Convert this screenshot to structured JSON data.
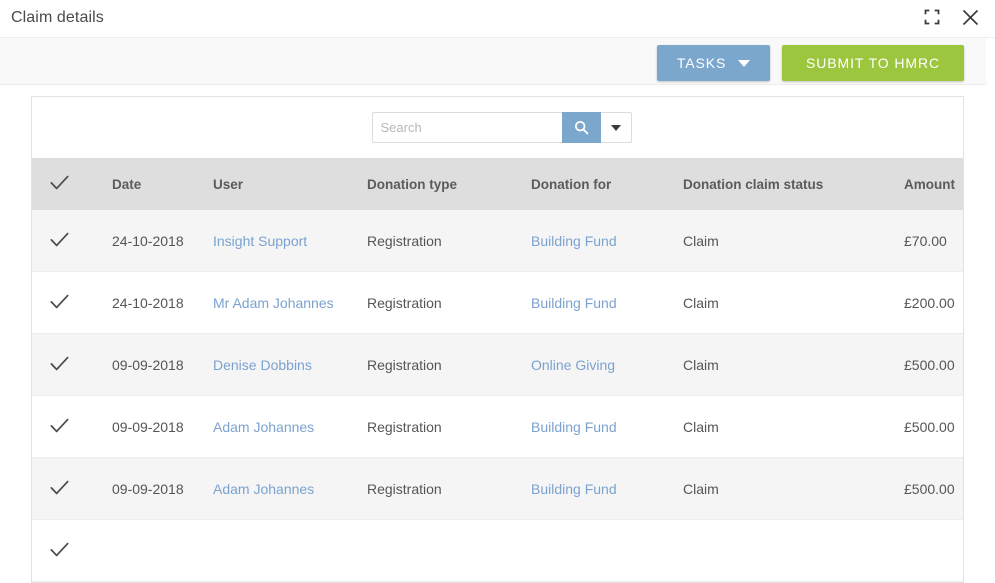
{
  "window": {
    "title": "Claim details",
    "expand_icon": "expand-icon",
    "close_icon": "close-icon"
  },
  "toolbar": {
    "tasks_label": "TASKS",
    "submit_label": "SUBMIT TO HMRC",
    "tasks_color": "#7ba7cd",
    "submit_color": "#9dc63f"
  },
  "search": {
    "placeholder": "Search",
    "value": "",
    "search_icon": "search-icon",
    "dropdown_icon": "chevron-down-icon"
  },
  "table": {
    "select_all_icon": "check-icon",
    "columns": [
      "Date",
      "User",
      "Donation type",
      "Donation for",
      "Donation claim status",
      "Amount"
    ],
    "rows": [
      {
        "date": "24-10-2018",
        "user": "Insight Support",
        "donation_type": "Registration",
        "donation_for": "Building Fund",
        "status": "Claim",
        "amount": "£70.00"
      },
      {
        "date": "24-10-2018",
        "user": "Mr Adam Johannes",
        "donation_type": "Registration",
        "donation_for": "Building Fund",
        "status": "Claim",
        "amount": "£200.00"
      },
      {
        "date": "09-09-2018",
        "user": "Denise Dobbins",
        "donation_type": "Registration",
        "donation_for": "Online Giving",
        "status": "Claim",
        "amount": "£500.00"
      },
      {
        "date": "09-09-2018",
        "user": "Adam Johannes",
        "donation_type": "Registration",
        "donation_for": "Building Fund",
        "status": "Claim",
        "amount": "£500.00"
      },
      {
        "date": "09-09-2018",
        "user": "Adam Johannes",
        "donation_type": "Registration",
        "donation_for": "Building Fund",
        "status": "Claim",
        "amount": "£500.00"
      },
      {
        "date": "",
        "user": "",
        "donation_type": "",
        "donation_for": "",
        "status": "",
        "amount": ""
      }
    ]
  }
}
